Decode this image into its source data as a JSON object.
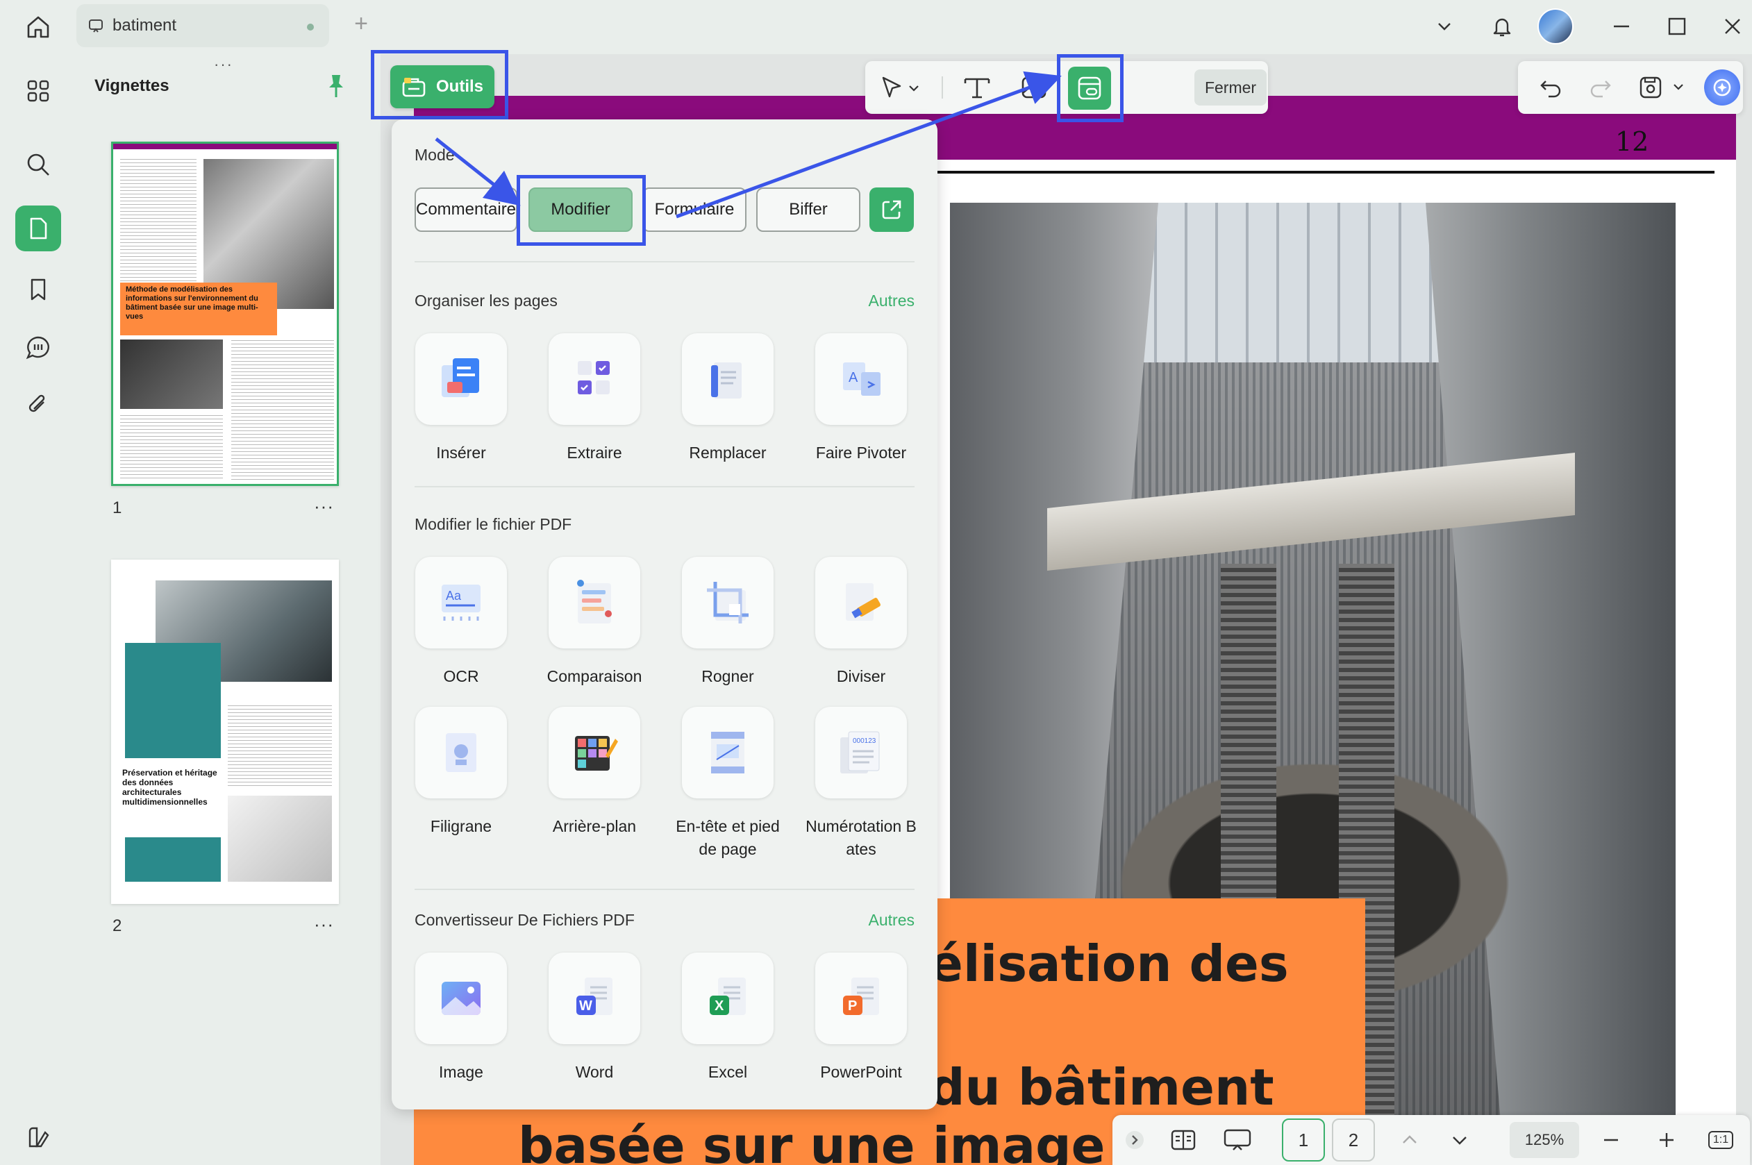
{
  "tab": {
    "title": "batiment"
  },
  "sidebar": {
    "title": "Vignettes",
    "pages": [
      {
        "number": "1",
        "more": "···"
      },
      {
        "number": "2",
        "more": "···"
      }
    ],
    "thumb1_heading": "Méthode de modélisation des informations sur l'environnement du bâtiment basée sur une image multi-vues",
    "thumb2_heading": "Préservation et héritage des données architecturales multidimensionnelles"
  },
  "toolbar": {
    "outils_label": "Outils",
    "fermer_label": "Fermer"
  },
  "document": {
    "page_number": "12",
    "title_line1": "élisation des",
    "title_line2": "du bâtiment",
    "title_line3": "basée sur une image mu"
  },
  "popup": {
    "mode_label": "Mode",
    "modes": [
      "Commentaire",
      "Modifier",
      "Formulaire",
      "Biffer"
    ],
    "sections": {
      "organize": {
        "title": "Organiser les pages",
        "more": "Autres",
        "tools": [
          "Insérer",
          "Extraire",
          "Remplacer",
          "Faire Pivoter"
        ]
      },
      "modify": {
        "title": "Modifier le fichier PDF",
        "tools": [
          "OCR",
          "Comparaison",
          "Rogner",
          "Diviser",
          "Filigrane",
          "Arrière-plan",
          "En-tête et pied de page",
          "Numérotation Bates"
        ]
      },
      "convert": {
        "title": "Convertisseur De Fichiers PDF",
        "more": "Autres",
        "tools": [
          "Image",
          "Word",
          "Excel",
          "PowerPoint"
        ]
      }
    }
  },
  "bottombar": {
    "pages": [
      "1",
      "2"
    ],
    "zoom": "125%",
    "fit_label": "1:1"
  }
}
